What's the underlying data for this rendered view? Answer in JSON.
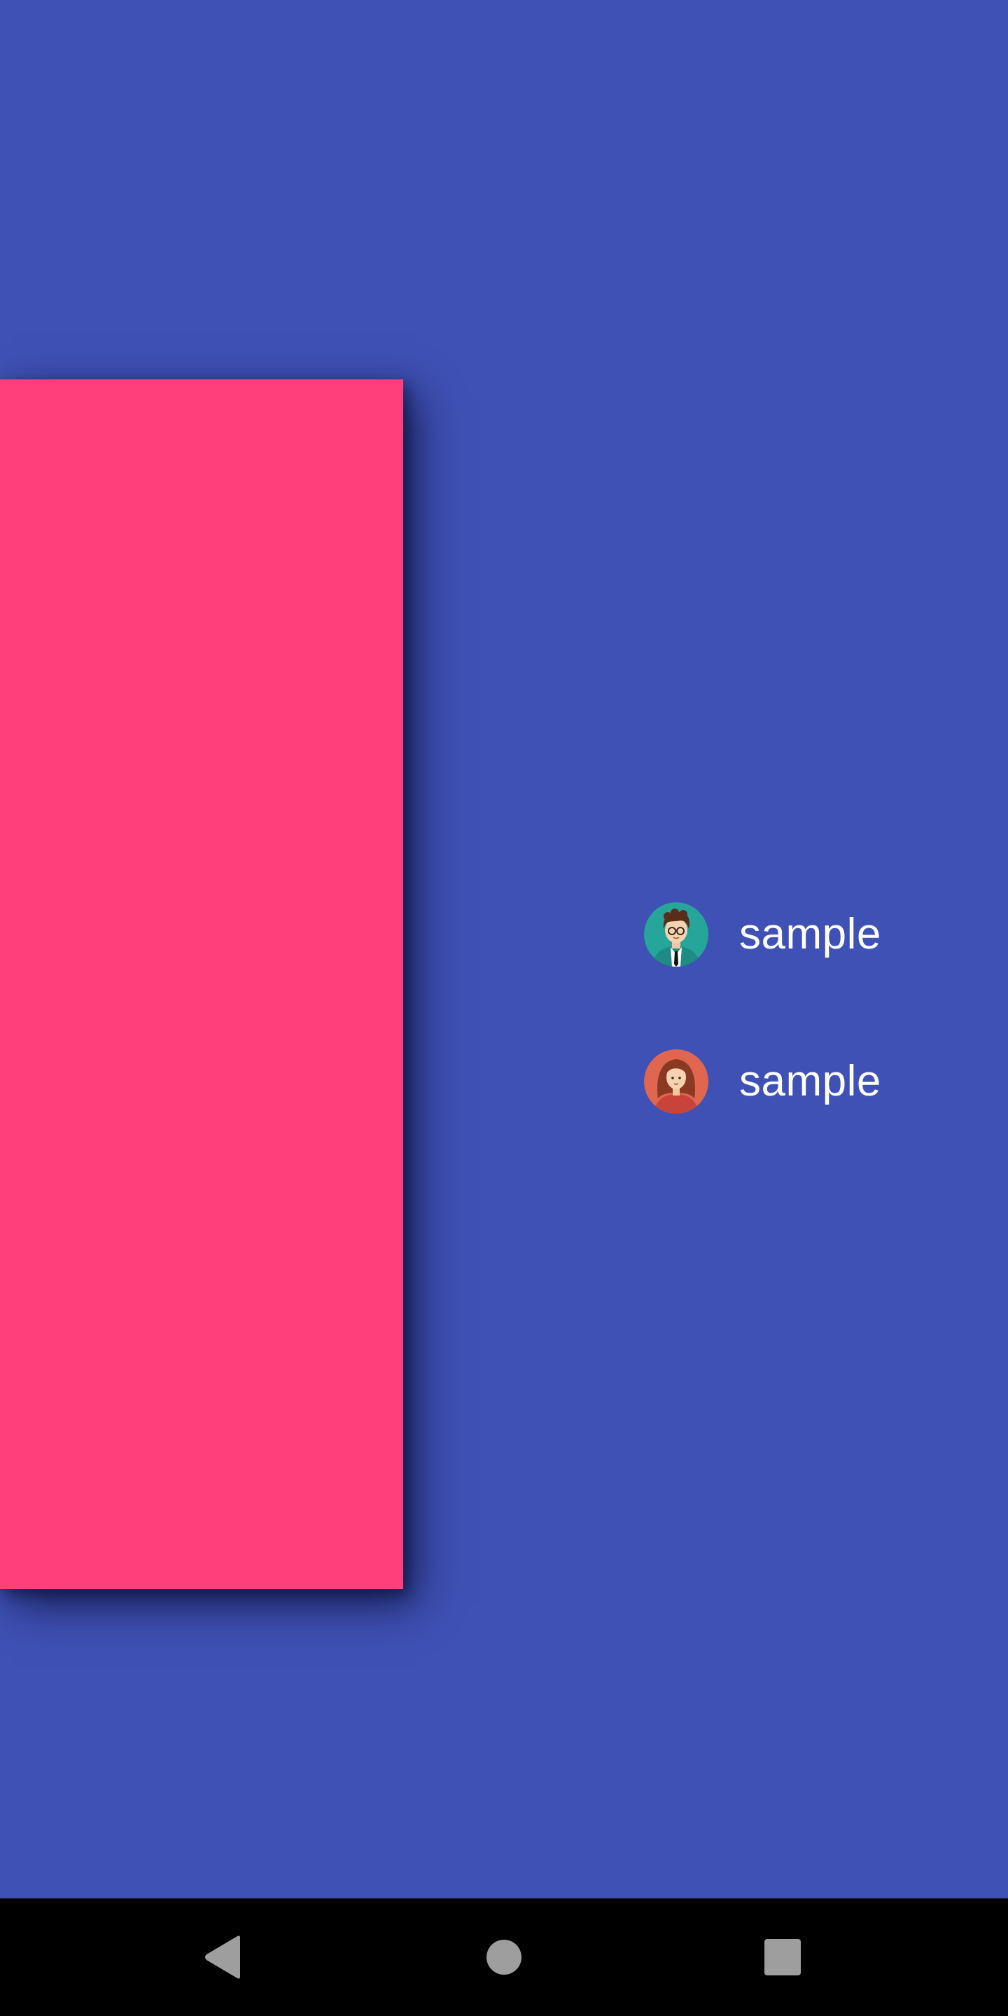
{
  "menu": {
    "items": [
      {
        "label": "sample",
        "avatar_icon": "male-avatar-icon",
        "avatar_bg": "#26a69a"
      },
      {
        "label": "sample",
        "avatar_icon": "female-avatar-icon",
        "avatar_bg": "#e0664f"
      }
    ]
  },
  "colors": {
    "background": "#3f51b5",
    "card": "#ff3f7c",
    "navbar": "#000000",
    "nav_icons": "#9e9e9e"
  },
  "navbar": {
    "buttons": [
      "back-icon",
      "home-icon",
      "recents-icon"
    ]
  }
}
